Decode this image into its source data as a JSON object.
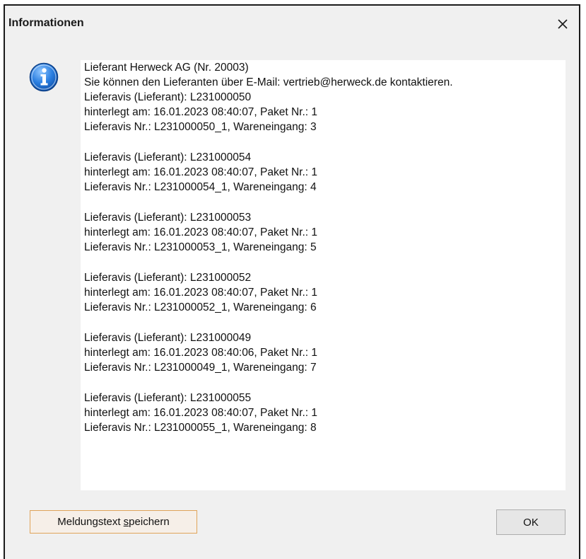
{
  "window": {
    "title": "Informationen",
    "close_glyph": "✕"
  },
  "icon": {
    "name": "information-icon",
    "accent": "#1f6fd1"
  },
  "message": {
    "header_lines": [
      "Lieferant Herweck AG (Nr. 20003)",
      "Sie können den Lieferanten über E-Mail: vertrieb@herweck.de kontaktieren."
    ],
    "entries": [
      {
        "lieferavis": "Lieferavis (Lieferant): L231000050",
        "hinterlegt": "hinterlegt am: 16.01.2023 08:40:07, Paket Nr.: 1",
        "nummer": "Lieferavis Nr.: L231000050_1, Wareneingang: 3"
      },
      {
        "lieferavis": "Lieferavis (Lieferant): L231000054",
        "hinterlegt": "hinterlegt am: 16.01.2023 08:40:07, Paket Nr.: 1",
        "nummer": "Lieferavis Nr.: L231000054_1, Wareneingang: 4"
      },
      {
        "lieferavis": "Lieferavis (Lieferant): L231000053",
        "hinterlegt": "hinterlegt am: 16.01.2023 08:40:07, Paket Nr.: 1",
        "nummer": "Lieferavis Nr.: L231000053_1, Wareneingang: 5"
      },
      {
        "lieferavis": "Lieferavis (Lieferant): L231000052",
        "hinterlegt": "hinterlegt am: 16.01.2023 08:40:07, Paket Nr.: 1",
        "nummer": "Lieferavis Nr.: L231000052_1, Wareneingang: 6"
      },
      {
        "lieferavis": "Lieferavis (Lieferant): L231000049",
        "hinterlegt": "hinterlegt am: 16.01.2023 08:40:06, Paket Nr.: 1",
        "nummer": "Lieferavis Nr.: L231000049_1, Wareneingang: 7"
      },
      {
        "lieferavis": "Lieferavis (Lieferant): L231000055",
        "hinterlegt": "hinterlegt am: 16.01.2023 08:40:07, Paket Nr.: 1",
        "nummer": "Lieferavis Nr.: L231000055_1, Wareneingang: 8"
      }
    ]
  },
  "buttons": {
    "save_prefix": "Meldungstext ",
    "save_mnemonic": "s",
    "save_suffix": "peichern",
    "ok_label": "OK"
  },
  "colors": {
    "dialog_bg": "#f0f0f0",
    "save_border": "#e0a45a"
  }
}
